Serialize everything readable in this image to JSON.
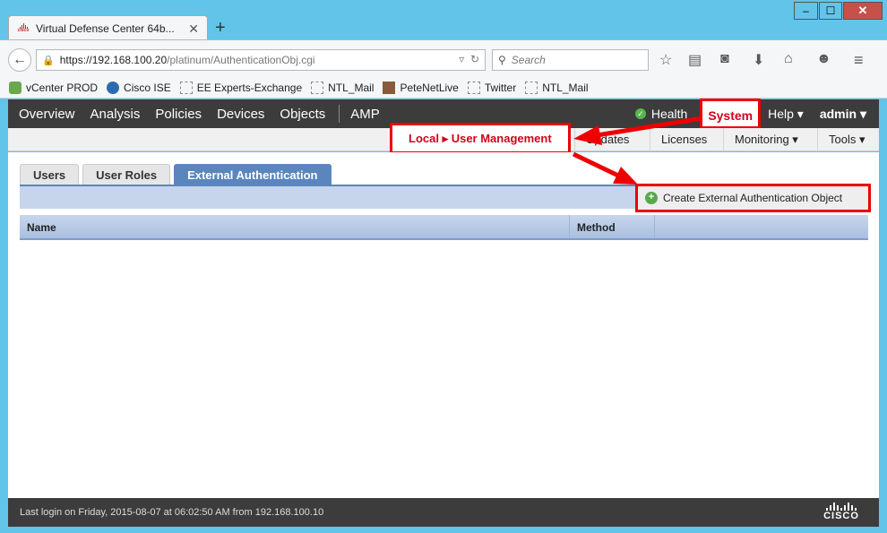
{
  "browser": {
    "tab_title": "Virtual Defense Center 64b...",
    "tab_favicon_text": "cisco",
    "tab_close": "✕",
    "new_tab": "+",
    "window_buttons": {
      "minimize": "‒",
      "maximize": "☐",
      "close": "✕"
    },
    "url_host": "https://192.168.100.20",
    "url_path": "/platinum/AuthenticationObj.cgi",
    "search_placeholder": "Search",
    "bookmarks": [
      "vCenter PROD",
      "Cisco ISE",
      "EE Experts-Exchange",
      "NTL_Mail",
      "PeteNetLive",
      "Twitter",
      "NTL_Mail"
    ]
  },
  "app": {
    "nav": [
      "Overview",
      "Analysis",
      "Policies",
      "Devices",
      "Objects",
      "AMP"
    ],
    "health": "Health",
    "system": "System",
    "help": "Help ▾",
    "admin": "admin ▾",
    "breadcrumb_local": "Local ▸ User Management",
    "subnav": [
      "Updates",
      "Licenses",
      "Monitoring ▾",
      "Tools ▾"
    ],
    "tabs": [
      "Users",
      "User Roles",
      "External Authentication"
    ],
    "create_button": "Create External Authentication Object",
    "columns": [
      "Name",
      "Method"
    ],
    "footer": "Last login on Friday, 2015-08-07 at 06:02:50 AM from 192.168.100.10",
    "cisco_logo": "CISCO"
  },
  "colors": {
    "annotation": "#ee0000",
    "accent": "#5a86bd",
    "dark_bar": "#3c3c3c"
  }
}
